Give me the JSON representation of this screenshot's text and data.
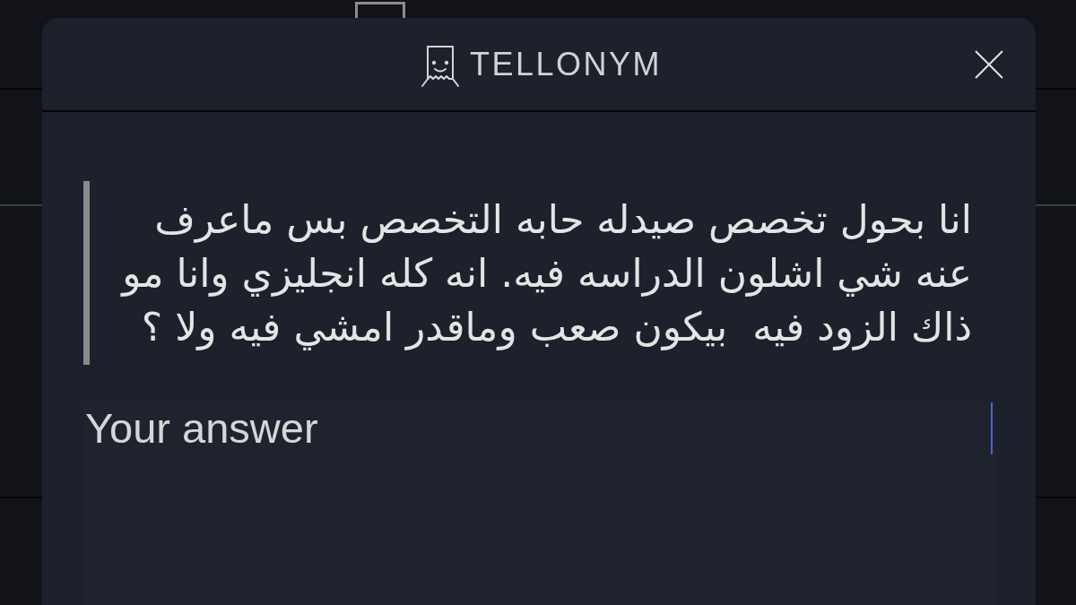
{
  "header": {
    "logo_text": "TELLONYM"
  },
  "question": {
    "text": "انا بحول تخصص صيدله حابه التخصص بس ماعرف عنه شي اشلون الدراسه فيه. انه كله انجليزي وانا مو ذاك الزود فيه  بيكون صعب وماقدر امشي فيه ولا ؟"
  },
  "answer_field": {
    "placeholder": "Your answer",
    "focused": true
  }
}
